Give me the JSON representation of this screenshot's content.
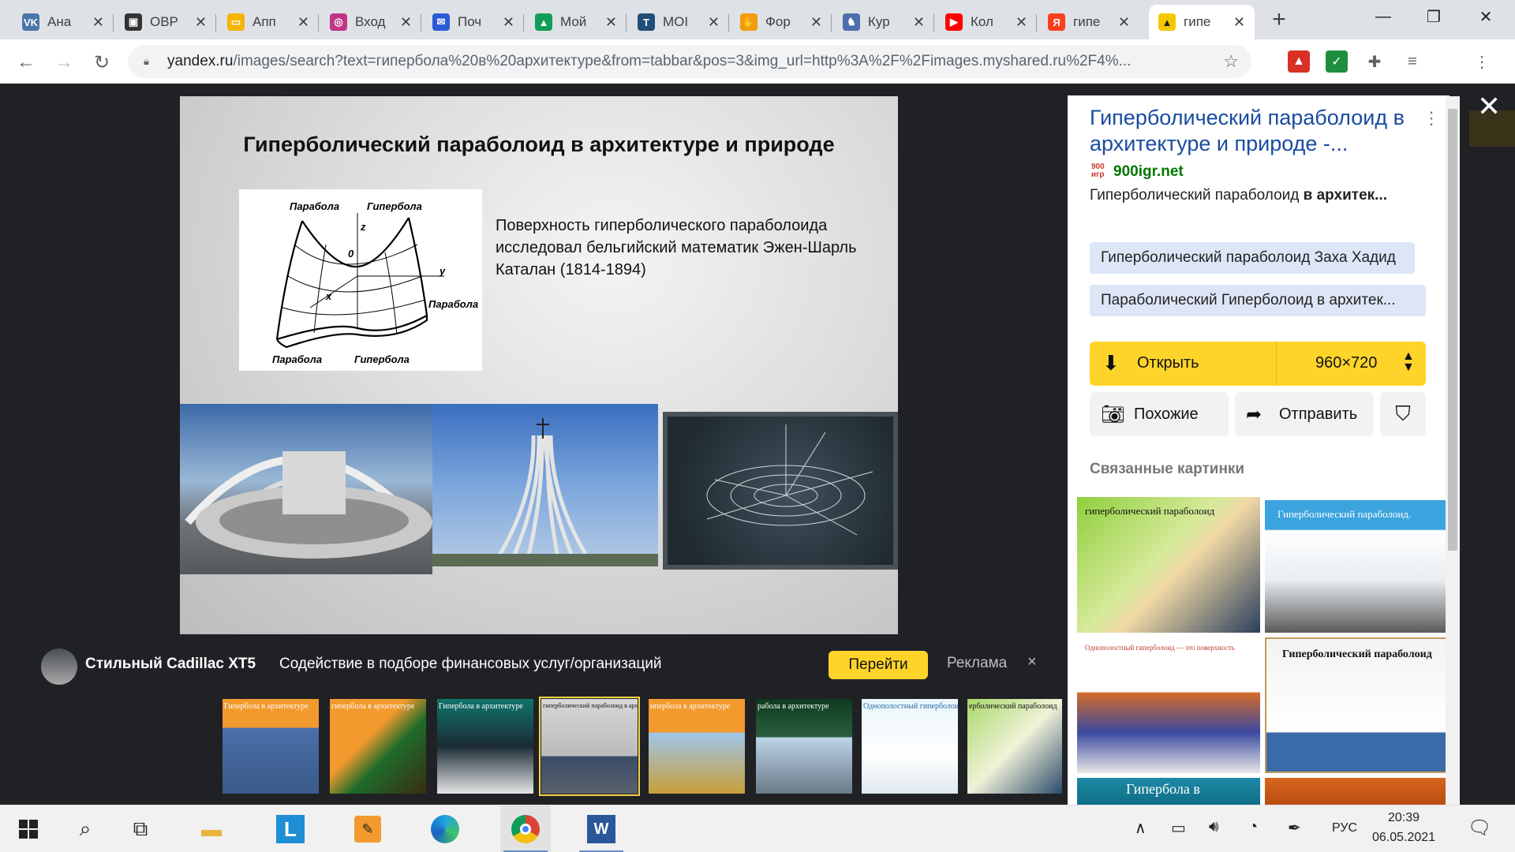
{
  "tabs": [
    {
      "label": "Ана",
      "icon": "vk-icon",
      "color": "#4a76a8",
      "glyph": "VK"
    },
    {
      "label": "ОВР",
      "icon": "presentation-icon",
      "color": "#333333",
      "glyph": "▣"
    },
    {
      "label": "Апп",
      "icon": "slides-icon",
      "color": "#f4b400",
      "glyph": "▭"
    },
    {
      "label": "Вход",
      "icon": "instagram-icon",
      "color": "#c13584",
      "glyph": "◎"
    },
    {
      "label": "Поч",
      "icon": "mail-icon",
      "color": "#2a5bd7",
      "glyph": "✉"
    },
    {
      "label": "Мой",
      "icon": "drive-icon",
      "color": "#0f9d58",
      "glyph": "▲"
    },
    {
      "label": "МОІ",
      "icon": "moodle-icon",
      "color": "#1f4e79",
      "glyph": "Т"
    },
    {
      "label": "Фор",
      "icon": "forms-icon",
      "color": "#f29b0c",
      "glyph": "✋"
    },
    {
      "label": "Кур",
      "icon": "owl-icon",
      "color": "#4e6fae",
      "glyph": "♞"
    },
    {
      "label": "Кол",
      "icon": "youtube-icon",
      "color": "#ff0000",
      "glyph": "▶"
    },
    {
      "label": "гипе",
      "icon": "yandex-icon",
      "color": "#fc3f1d",
      "glyph": "Я"
    },
    {
      "label": "гипе",
      "icon": "yandex-images-icon",
      "color": "#f6c800",
      "glyph": "▲"
    }
  ],
  "address": {
    "url_host": "yandex.ru",
    "url_rest": "/images/search?text=гипербола%20в%20архитектуре&from=tabbar&pos=3&img_url=http%3A%2F%2Fimages.myshared.ru%2F4%..."
  },
  "slide": {
    "title": "Гиперболический параболоид в архитектуре и природе",
    "text": "Поверхность гиперболического параболоида исследовал бельгийский математик Эжен-Шарль Каталан (1814-1894)",
    "diagram_labels": {
      "top_left": "Парабола",
      "top_right": "Гипербола",
      "z": "z",
      "o": "0",
      "y": "y",
      "x": "x",
      "right": "Парабола",
      "bottom_left": "Парабола",
      "bottom_right": "Гипербола"
    }
  },
  "ad": {
    "name": "Стильный Cadillac XT5",
    "text": "Содействие в подборе финансовых услуг/организаций",
    "go": "Перейти",
    "label": "Реклама",
    "close": "×"
  },
  "thumbnails": [
    {
      "caption": "Гипербола в архитектуре"
    },
    {
      "caption": "гипербола в архитектуре"
    },
    {
      "caption": "Гипербола в архитектуре"
    },
    {
      "caption": "гиперболический параболоид в архитектуре и природе"
    },
    {
      "caption": "ипербола в архитектуре"
    },
    {
      "caption": "рабола в архитектуре"
    },
    {
      "caption": "Однополостный гиперболоид"
    },
    {
      "caption": "ерболический параболоид"
    }
  ],
  "panel": {
    "title": "Гиперболический параболоид в архитектуре и природе -...",
    "site_logo": "900 игр",
    "site": "900igr.net",
    "desc_plain": "Гиперболический параболоид ",
    "desc_bold": "в архитек...",
    "chips": [
      "Гиперболический параболоид Заха Хадид",
      "Параболический Гиперболоид в архитек..."
    ],
    "open_label": "Открыть",
    "size": "960×720",
    "similar_label": "Похожие",
    "share_label": "Отправить",
    "related_label": "Связанные картинки",
    "related": [
      {
        "caption": "гиперболический параболоид"
      },
      {
        "caption": "Гиперболический параболоид."
      },
      {
        "caption": "Однополостный гиперболоид — это поверхность"
      },
      {
        "caption": "Гиперболический параболоид"
      },
      {
        "caption": "Гипербола в"
      }
    ]
  },
  "taskbar": {
    "lang": "РУС",
    "time": "20:39",
    "date": "06.05.2021"
  },
  "colors": {
    "accent": "#fed42b",
    "link": "#1a4ba0",
    "site": "#007700"
  }
}
